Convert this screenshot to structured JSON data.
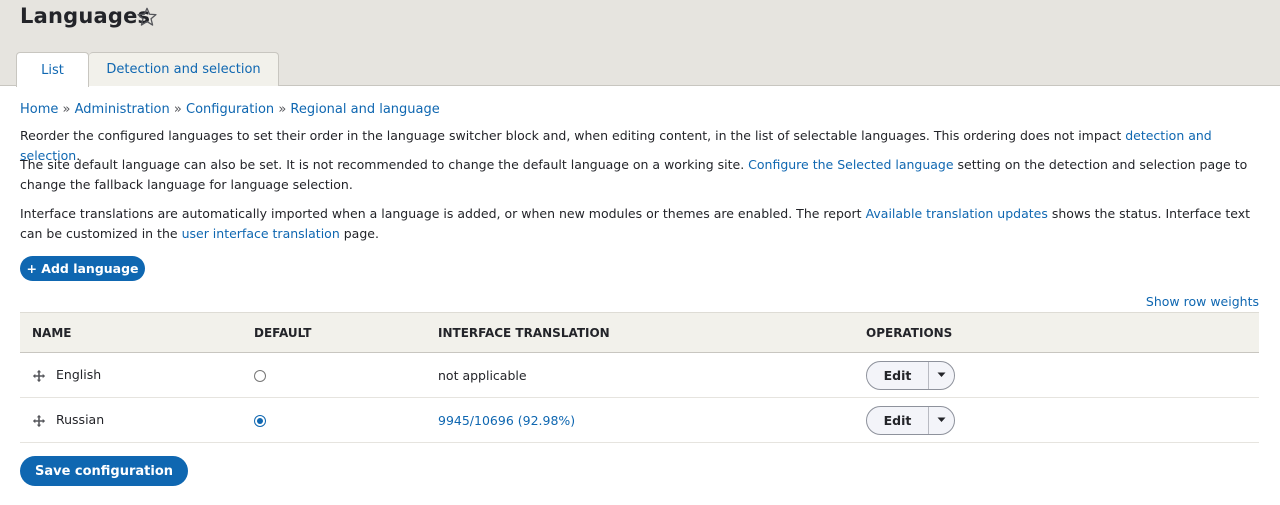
{
  "header": {
    "title": "Languages",
    "tabs": [
      {
        "label": "List"
      },
      {
        "label": "Detection and selection"
      }
    ]
  },
  "breadcrumb": {
    "items": [
      "Home",
      "Administration",
      "Configuration",
      "Regional and language"
    ],
    "separator": "»"
  },
  "description": {
    "p1_text": "Reorder the configured languages to set their order in the language switcher block and, when editing content, in the list of selectable languages. This ordering does not impact ",
    "p1_link": "detection and selection",
    "p1_end": ".",
    "p2_text": "The site default language can also be set. It is not recommended to change the default language on a working site. ",
    "p2_link": "Configure the Selected language",
    "p2_end": " setting on the detection and selection page to change the fallback language for language selection.",
    "p3_text": "Interface translations are automatically imported when a language is added, or when new modules or themes are enabled. The report ",
    "p3_link": "Available translation updates",
    "p3_mid": " shows the status. Interface text can be customized in the ",
    "p3_link2": "user interface translation",
    "p3_end": " page."
  },
  "actions": {
    "add_language": "+ Add language",
    "show_row_weights": "Show row weights",
    "save": "Save configuration"
  },
  "table": {
    "columns": [
      "NAME",
      "DEFAULT",
      "INTERFACE TRANSLATION",
      "OPERATIONS"
    ],
    "rows": [
      {
        "name": "English",
        "default": false,
        "translation": "not applicable",
        "translation_is_link": false,
        "operation": "Edit"
      },
      {
        "name": "Russian",
        "default": true,
        "translation": "9945/10696 (92.98%)",
        "translation_is_link": true,
        "operation": "Edit"
      }
    ]
  },
  "colors": {
    "accent": "#0f67b1",
    "header_bg": "#e6e4df",
    "text": "#232429"
  },
  "icons": {
    "favorite": "star-outline-icon",
    "drag": "drag-handle-icon",
    "toggle": "caret-down-icon"
  }
}
